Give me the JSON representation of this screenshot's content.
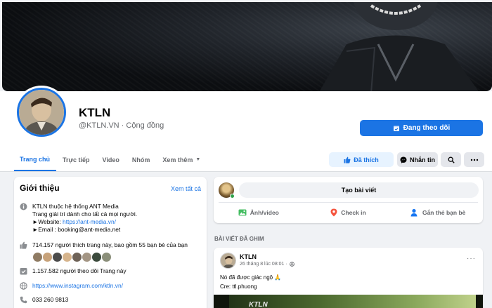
{
  "page": {
    "name": "KTLN",
    "handle": "@KTLN.VN",
    "category": "Cộng đồng",
    "sub_line": "@KTLN.VN · Cộng đồng",
    "follow_button": "Đang theo dõi"
  },
  "tabs": [
    "Trang chủ",
    "Trực tiếp",
    "Video",
    "Nhóm",
    "Xem thêm"
  ],
  "actions": {
    "liked": "Đã thích",
    "message": "Nhắn tin"
  },
  "intro": {
    "title": "Giới thiệu",
    "see_all": "Xem tất cả",
    "bio": [
      "KTLN thuộc hệ thống ANT Media",
      "Trang giải trí dành cho tất cả mọi người.",
      "►Website: ",
      "►Email : booking@ant-media.net"
    ],
    "website_url": "https://ant-media.vn/",
    "likes": "714.157 người thích trang này, bao gồm 55 bạn bè của bạn",
    "followers": "1.157.582 người theo dõi Trang này",
    "instagram": "https://www.instagram.com/ktln.vn/",
    "phone": "033 260 9813"
  },
  "create_post": {
    "button": "Tạo bài viết",
    "options": [
      "Ảnh/video",
      "Check in",
      "Gắn thẻ bạn bè"
    ]
  },
  "pinned": {
    "label": "BÀI VIẾT ĐÃ GHIM",
    "author": "KTLN",
    "time": "26 tháng 8 lúc 08:01 ·",
    "text_lines": [
      "Nó đã được giác ngộ 🙏",
      "Cre: ttl.phuong"
    ],
    "image_brand": "KTLN"
  },
  "colors": {
    "accent": "#1b74e4",
    "background": "#f0f2f5",
    "liked_bg": "#e7f3ff",
    "photo_green": "#45bd62",
    "checkin_red": "#f5533d",
    "tag_blue": "#1877f2"
  }
}
